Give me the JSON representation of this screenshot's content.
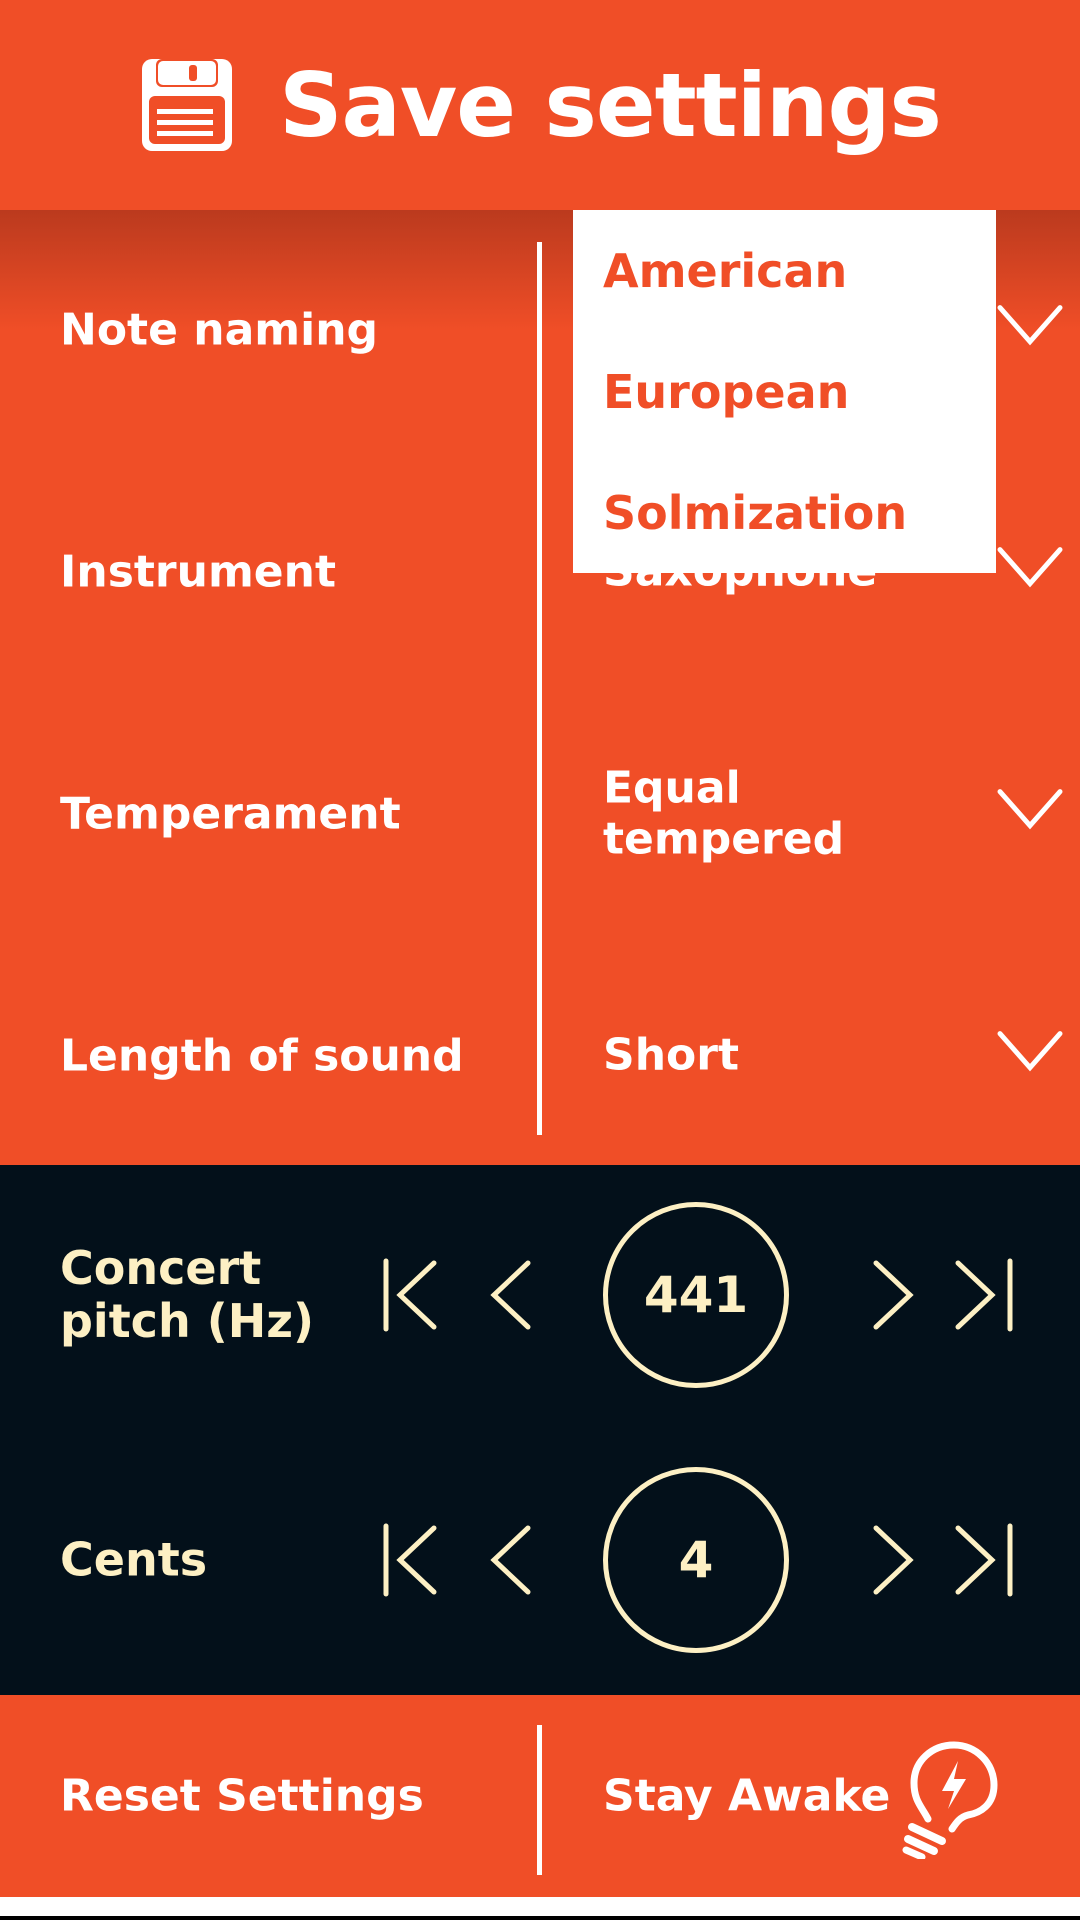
{
  "header": {
    "title": "Save settings",
    "icon": "floppy-disk-icon"
  },
  "settings": {
    "rows": [
      {
        "label": "Note naming",
        "value": "American"
      },
      {
        "label": "Instrument",
        "value": "Saxophone"
      },
      {
        "label": "Temperament",
        "value": "Equal tempered"
      },
      {
        "label": "Length of sound",
        "value": "Short"
      }
    ],
    "dropdown": {
      "open_for": "Note naming",
      "options": [
        "American",
        "European",
        "Solmization"
      ]
    }
  },
  "steppers": [
    {
      "label": "Concert pitch (Hz)",
      "value": "441"
    },
    {
      "label": "Cents",
      "value": "4"
    }
  ],
  "footer": {
    "reset_label": "Reset Settings",
    "stay_awake_label": "Stay Awake",
    "stay_awake_icon": "lightbulb-bolt-icon"
  },
  "colors": {
    "accent": "#f04e27",
    "dark": "#03101a",
    "cream": "#fdf0c4",
    "white": "#ffffff"
  }
}
